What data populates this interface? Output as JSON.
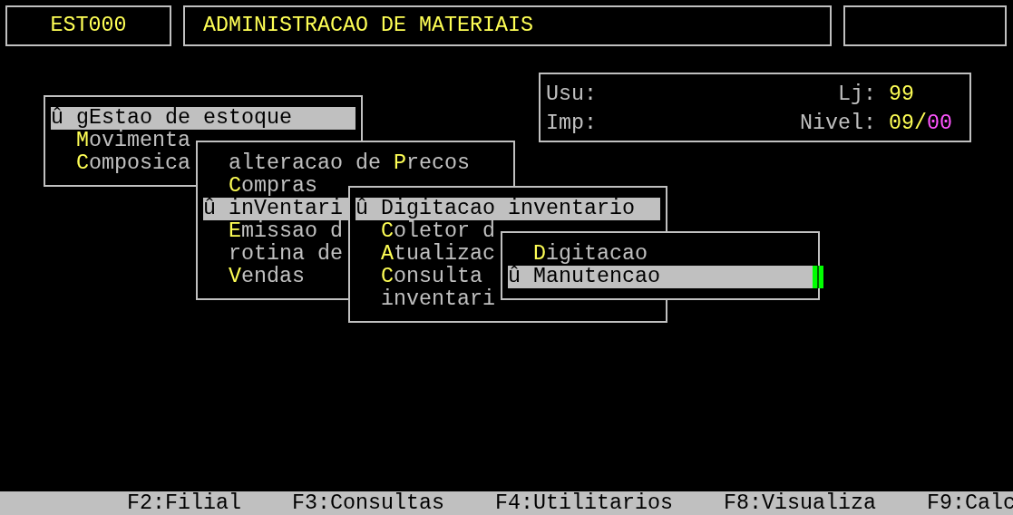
{
  "header": {
    "program_code": "EST000",
    "title": "ADMINISTRACAO DE MATERIAIS"
  },
  "info_panel": {
    "user_label": "Usu:",
    "printer_label": "Imp:",
    "store_label": "Lj:",
    "store_value": "99",
    "level_label": "Nivel:",
    "level_value": "09/",
    "sublevel_value": "00"
  },
  "menus": [
    {
      "selection_marker": "û",
      "items": [
        {
          "pre": "g",
          "key": "E",
          "post": "stao de estoque",
          "selected": true
        },
        {
          "key": "M",
          "post": "ovimenta",
          "selected": false
        },
        {
          "key": "C",
          "post": "omposica",
          "selected": false
        }
      ]
    },
    {
      "selection_marker": "û",
      "items": [
        {
          "pre": "alteracao de ",
          "key": "P",
          "post": "recos",
          "selected": false
        },
        {
          "key": "C",
          "post": "ompras",
          "selected": false
        },
        {
          "pre": "in",
          "key": "V",
          "post": "entari",
          "selected": true
        },
        {
          "key": "E",
          "post": "missao d",
          "selected": false
        },
        {
          "pre": "rotina de",
          "selected": false
        },
        {
          "key": "V",
          "post": "endas",
          "selected": false
        }
      ]
    },
    {
      "selection_marker": "û",
      "items": [
        {
          "pre": "Digitacao inventario",
          "selected": true
        },
        {
          "key": "C",
          "post": "oletor d",
          "selected": false
        },
        {
          "key": "A",
          "post": "tualizac",
          "selected": false
        },
        {
          "key": "C",
          "post": "onsulta",
          "selected": false
        },
        {
          "pre": "inventari",
          "selected": false
        }
      ]
    },
    {
      "selection_marker": "û",
      "items": [
        {
          "key": "D",
          "post": "igitacao",
          "selected": false
        },
        {
          "pre": "Manutencao",
          "selected": true
        }
      ]
    }
  ],
  "status_bar": [
    "F2:Filial",
    "F3:Consultas",
    "F4:Utilitarios",
    "F8:Visualiza",
    "F9:Calc"
  ]
}
